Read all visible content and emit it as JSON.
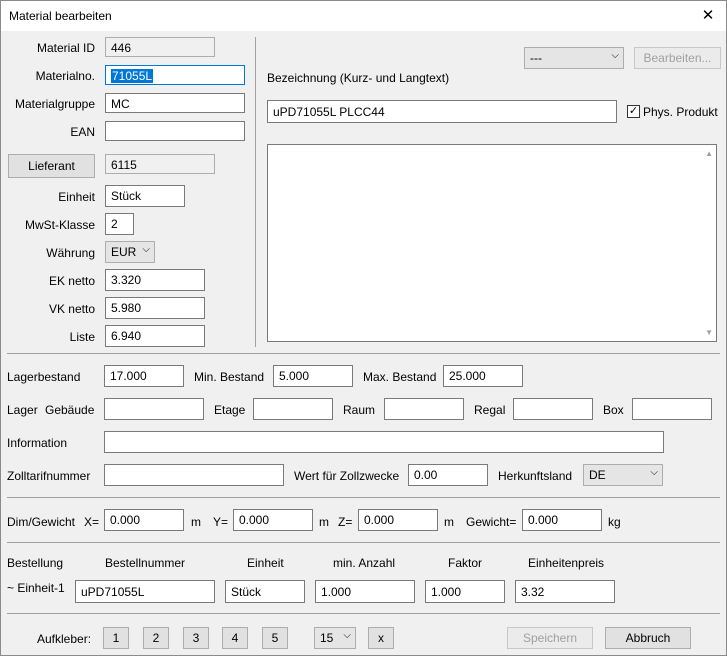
{
  "window": {
    "title": "Material bearbeiten",
    "close_glyph": "✕"
  },
  "material": {
    "id_label": "Material ID",
    "id_value": "446",
    "nr_label": "Materialno.",
    "nr_value": "71055L",
    "gruppe_label": "Materialgruppe",
    "gruppe_value": "MC",
    "ean_label": "EAN",
    "ean_value": "",
    "lieferant_button": "Lieferant",
    "lieferant_value": "6115",
    "einheit_label": "Einheit",
    "einheit_value": "Stück",
    "mwst_label": "MwSt-Klasse",
    "mwst_value": "2",
    "waehrung_label": "Währung",
    "waehrung_value": "EUR",
    "ek_label": "EK netto",
    "ek_value": "3.320",
    "vk_label": "VK netto",
    "vk_value": "5.980",
    "liste_label": "Liste",
    "liste_value": "6.940"
  },
  "right_panel": {
    "select_value": "---",
    "bearbeiten_button": "Bearbeiten...",
    "bezeichnung_label": "Bezeichnung (Kurz- und Langtext)",
    "bezeichnung_value": "uPD71055L PLCC44",
    "phys_produkt_label": "Phys. Produkt",
    "phys_produkt_checked": true,
    "langtext_value": ""
  },
  "lager": {
    "bestand_label": "Lagerbestand",
    "bestand_value": "17.000",
    "min_label": "Min. Bestand",
    "min_value": "5.000",
    "max_label": "Max. Bestand",
    "max_value": "25.000",
    "lager_label": "Lager",
    "gebaeude_label": "Gebäude",
    "gebaeude_value": "",
    "etage_label": "Etage",
    "etage_value": "",
    "raum_label": "Raum",
    "raum_value": "",
    "regal_label": "Regal",
    "regal_value": "",
    "box_label": "Box",
    "box_value": "",
    "info_label": "Information",
    "info_value": "",
    "zolltarif_label": "Zolltarifnummer",
    "zolltarif_value": "",
    "zollwert_label": "Wert für Zollzwecke",
    "zollwert_value": "0.00",
    "herkunft_label": "Herkunftsland",
    "herkunft_value": "DE"
  },
  "dim": {
    "label": "Dim/Gewicht",
    "x_label": "X=",
    "x_value": "0.000",
    "x_unit": "m",
    "y_label": "Y=",
    "y_value": "0.000",
    "y_unit": "m",
    "z_label": "Z=",
    "z_value": "0.000",
    "z_unit": "m",
    "gewicht_label": "Gewicht=",
    "gewicht_value": "0.000",
    "gewicht_unit": "kg"
  },
  "bestellung": {
    "label": "Bestellung",
    "col_nr": "Bestellnummer",
    "col_einheit": "Einheit",
    "col_min": "min. Anzahl",
    "col_faktor": "Faktor",
    "col_preis": "Einheitenpreis",
    "row_label": "~ Einheit-1",
    "row": {
      "nr": "uPD71055L",
      "einheit": "Stück",
      "min": "1.000",
      "faktor": "1.000",
      "preis": "3.32"
    }
  },
  "footer": {
    "aufkleber_label": "Aufkleber:",
    "aufkleber_buttons": [
      "1",
      "2",
      "3",
      "4",
      "5"
    ],
    "count_value": "15",
    "x_button": "x",
    "speichern_button": "Speichern",
    "abbruch_button": "Abbruch"
  }
}
